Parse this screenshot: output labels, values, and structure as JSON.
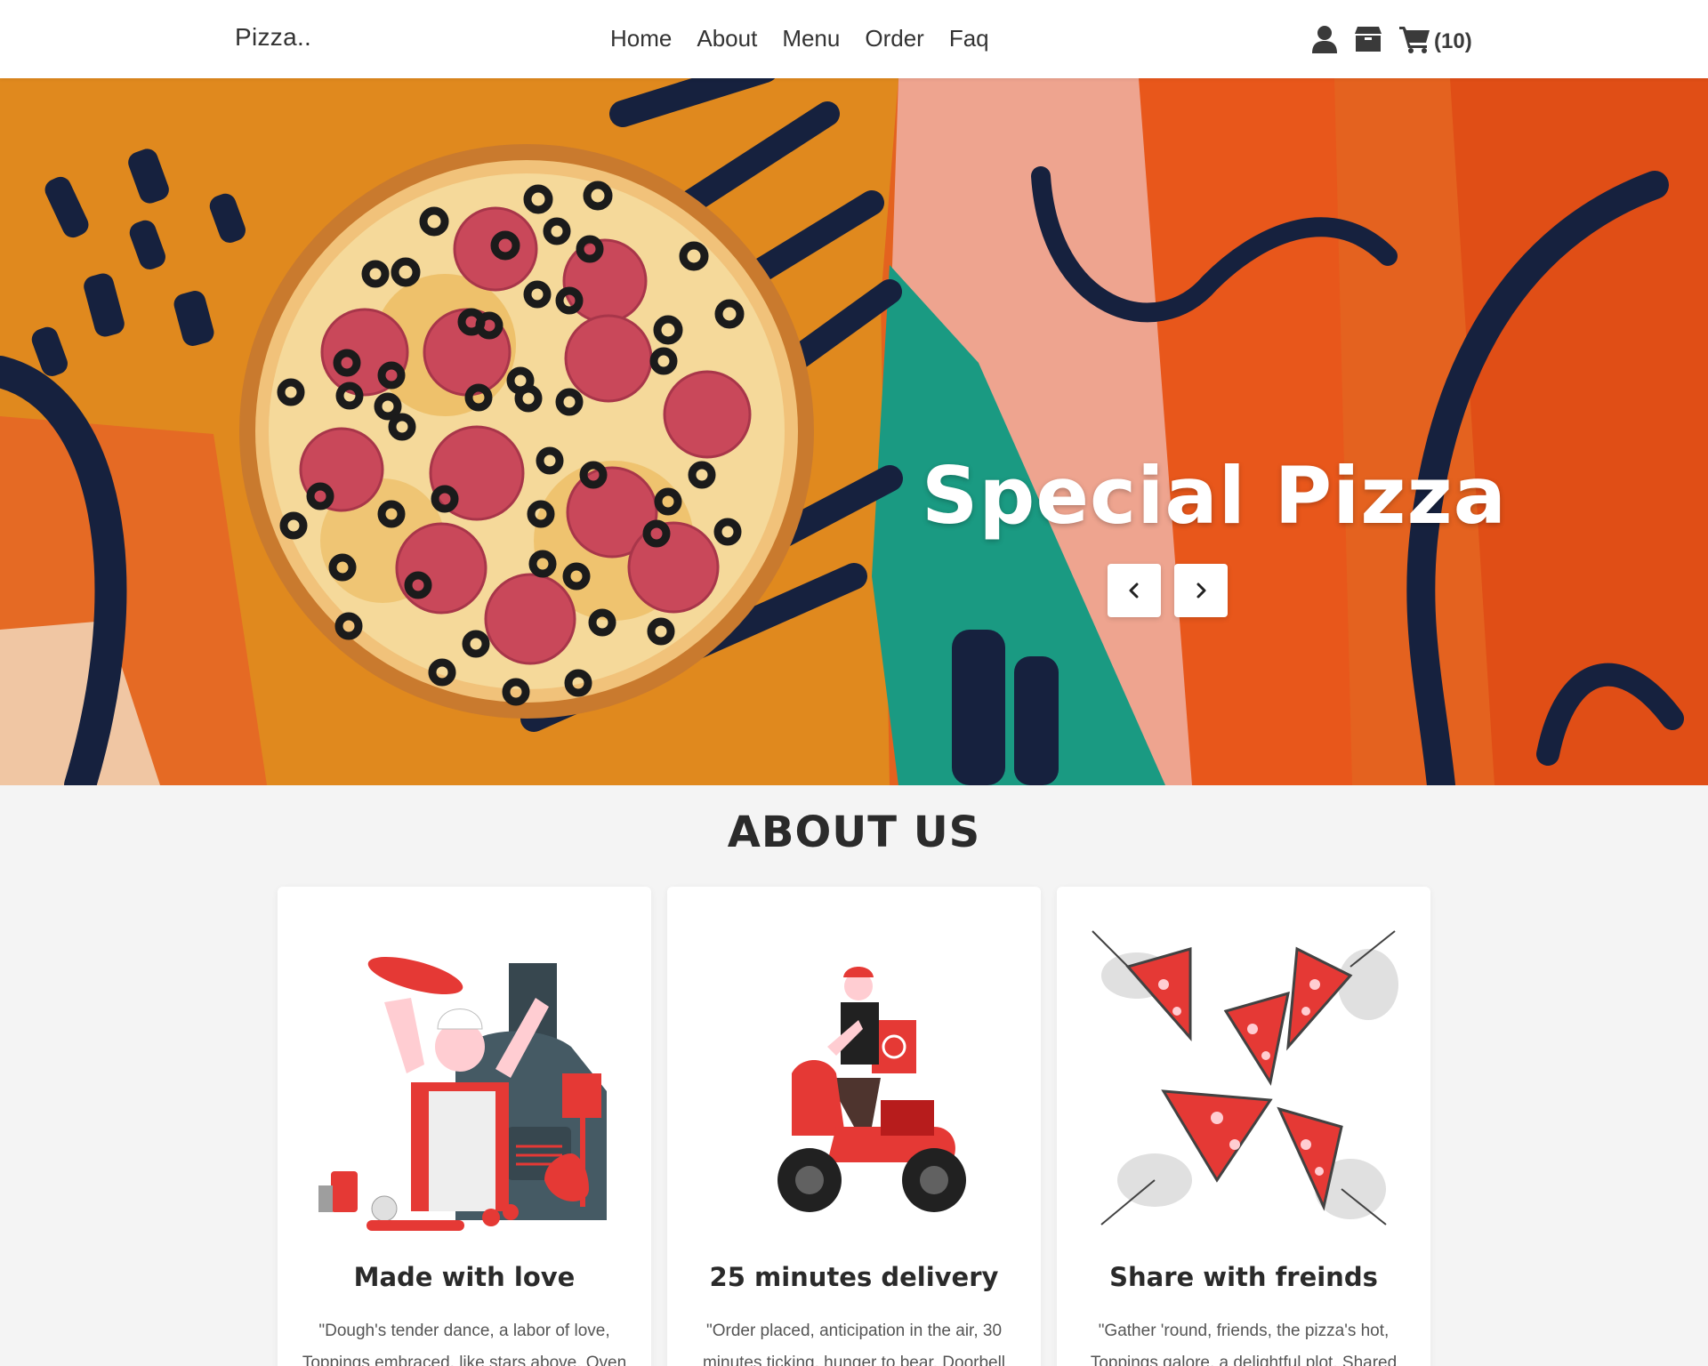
{
  "nav": {
    "brand": "Pizza..",
    "links": [
      "Home",
      "About",
      "Menu",
      "Order",
      "Faq"
    ],
    "icons": [
      "user-icon",
      "box-icon",
      "cart-icon"
    ],
    "cart_count": "(10)"
  },
  "hero": {
    "title": "Special Pizza",
    "prev_icon": "chevron-left-icon",
    "next_icon": "chevron-right-icon"
  },
  "about": {
    "title": "ABOUT US",
    "cards": [
      {
        "title": "Made with love",
        "text": "\"Dough's tender dance, a labor of love, Toppings embraced, like stars above. Oven"
      },
      {
        "title": "25 minutes delivery",
        "text": "\"Order placed, anticipation in the air, 30 minutes ticking, hunger to bear. Doorbell"
      },
      {
        "title": "Share with freinds",
        "text": "\"Gather 'round, friends, the pizza's hot, Toppings galore, a delightful plot. Shared"
      }
    ]
  },
  "colors": {
    "accent_red": "#e53935",
    "hero_orange": "#e4621f",
    "hero_navy": "#16213e",
    "hero_teal": "#1a9a82"
  }
}
